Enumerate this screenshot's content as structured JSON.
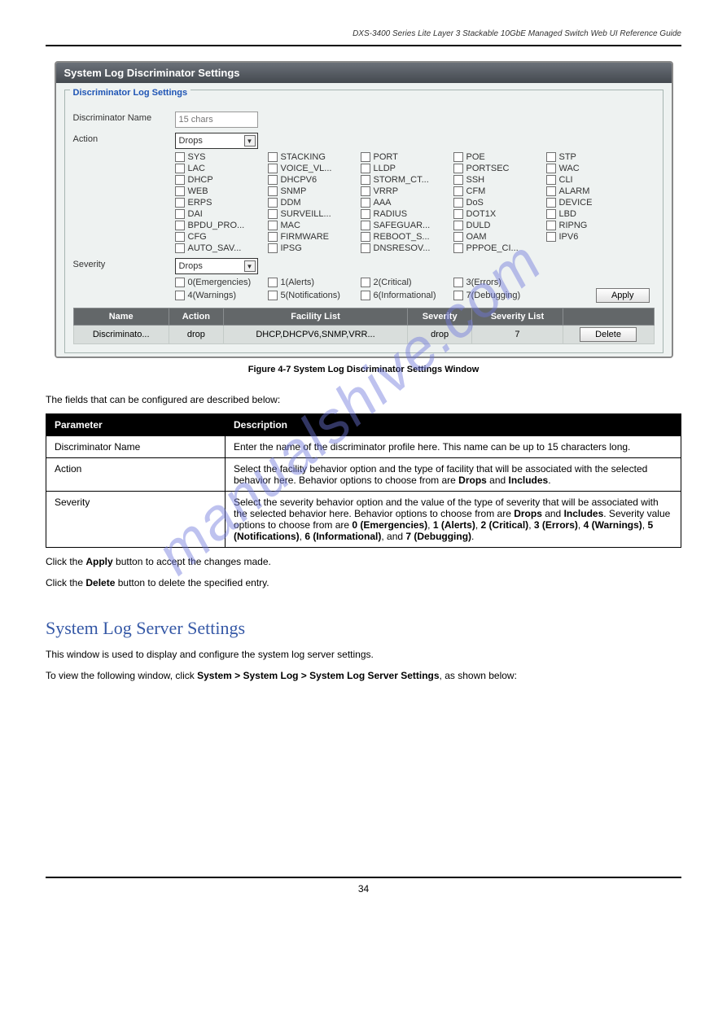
{
  "breadcrumb": "DXS-3400 Series Lite Layer 3 Stackable 10GbE Managed Switch Web UI Reference Guide",
  "screenshot": {
    "title": "System Log Discriminator Settings",
    "legend": "Discriminator Log Settings",
    "discriminator_label": "Discriminator Name",
    "discriminator_placeholder": "15 chars",
    "action_label": "Action",
    "action_value": "Drops",
    "facility_opts": [
      [
        "SYS",
        "STACKING",
        "PORT",
        "POE",
        "STP"
      ],
      [
        "LAC",
        "VOICE_VL...",
        "LLDP",
        "PORTSEC",
        "WAC"
      ],
      [
        "DHCP",
        "DHCPV6",
        "STORM_CT...",
        "SSH",
        "CLI"
      ],
      [
        "WEB",
        "SNMP",
        "VRRP",
        "CFM",
        "ALARM"
      ],
      [
        "ERPS",
        "DDM",
        "AAA",
        "DoS",
        "DEVICE"
      ],
      [
        "DAI",
        "SURVEILL...",
        "RADIUS",
        "DOT1X",
        "LBD"
      ],
      [
        "BPDU_PRO...",
        "MAC",
        "SAFEGUAR...",
        "DULD",
        "RIPNG"
      ],
      [
        "CFG",
        "FIRMWARE",
        "REBOOT_S...",
        "OAM",
        "IPV6"
      ],
      [
        "AUTO_SAV...",
        "IPSG",
        "DNSRESOV...",
        "PPPOE_CI...",
        ""
      ]
    ],
    "severity_label": "Severity",
    "severity_value": "Drops",
    "severity_opts1": [
      "0(Emergencies)",
      "1(Alerts)",
      "2(Critical)",
      "3(Errors)"
    ],
    "severity_opts2": [
      "4(Warnings)",
      "5(Notifications)",
      "6(Informational)",
      "7(Debugging)"
    ],
    "apply": "Apply",
    "table_headers": [
      "Name",
      "Action",
      "Facility List",
      "Severity",
      "Severity List",
      ""
    ],
    "table_row": [
      "Discriminato...",
      "drop",
      "DHCP,DHCPV6,SNMP,VRR...",
      "drop",
      "7"
    ],
    "delete": "Delete"
  },
  "fig_caption": "Figure 4-7 System Log Discriminator Settings Window",
  "intro_para": "The fields that can be configured are described below:",
  "desc_table": {
    "h_param": "Parameter",
    "h_desc": "Description",
    "rows": [
      {
        "param": "Discriminator Name",
        "desc": "Enter the name of the discriminator profile here. This name can be up to 15 characters long."
      },
      {
        "param": "Action",
        "desc_html": "Select the facility behavior option and the type of facility that will be associated with the selected behavior here. Behavior options to choose from are <b>Drops</b> and <b>Includes</b>."
      },
      {
        "param": "Severity",
        "desc_html": "Select the severity behavior option and the value of the type of severity that will be associated with the selected behavior here. Behavior options to choose from are <b>Drops</b> and <b>Includes</b>. Severity value options to choose from are <b>0 (Emergencies)</b>, <b>1 (Alerts)</b>, <b>2 (Critical)</b>, <b>3 (Errors)</b>, <b>4 (Warnings)</b>, <b>5 (Notifications)</b>, <b>6 (Informational)</b>, and <b>7 (Debugging)</b>."
      }
    ]
  },
  "post1_html": "Click the <b>Apply</b> button to accept the changes made.",
  "post2_html": "Click the <b>Delete</b> button to delete the specified entry.",
  "section_title": "System Log Server Settings",
  "section_para": "This window is used to display and configure the system log server settings.",
  "nav_html": "To view the following window, click <b>System > System Log > System Log Server Settings</b>, as shown below:",
  "page_num": "34",
  "watermark": "manualshive.com"
}
